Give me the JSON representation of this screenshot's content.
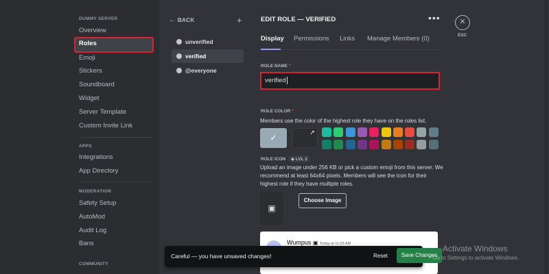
{
  "sidebar": {
    "server_heading": "DUMMY SERVER",
    "items": [
      "Overview",
      "Roles",
      "Emoji",
      "Stickers",
      "Soundboard",
      "Widget",
      "Server Template",
      "Custom Invite Link"
    ],
    "apps_heading": "APPS",
    "apps_items": [
      "Integrations",
      "App Directory"
    ],
    "moderation_heading": "MODERATION",
    "moderation_items": [
      "Safety Setup",
      "AutoMod",
      "Audit Log",
      "Bans"
    ],
    "community_heading": "COMMUNITY"
  },
  "roles_panel": {
    "back_label": "BACK",
    "add_icon": "plus-icon",
    "roles": [
      "unverified",
      "verified",
      "@everyone"
    ]
  },
  "main": {
    "title": "EDIT ROLE — VERIFIED",
    "more_icon": "ellipsis-icon",
    "esc_label": "ESC",
    "tabs": [
      "Display",
      "Permissions",
      "Links",
      "Manage Members (0)"
    ],
    "role_name_label": "ROLE NAME",
    "role_name_value": "verified",
    "role_color_label": "ROLE COLOR",
    "role_color_desc": "Members use the color of the highest role they have on the roles list.",
    "default_color": "#99aab5",
    "swatches_row1": [
      "#1abc9c",
      "#2ecc71",
      "#3498db",
      "#9b59b6",
      "#e91e63",
      "#f1c40f",
      "#e67e22",
      "#e74c3c",
      "#95a5a6",
      "#607d8b"
    ],
    "swatches_row2": [
      "#11806a",
      "#1f8b4c",
      "#206694",
      "#71368a",
      "#ad1457",
      "#c27c0e",
      "#a84300",
      "#992d22",
      "#979c9f",
      "#546e7a"
    ],
    "role_icon_label": "ROLE ICON",
    "lvl_badge": "LVL 2",
    "role_icon_desc": "Upload an image under 256 KB or pick a custom emoji from this server. We recommend at least 64x64 pixels. Members will see the icon for their highest role if they have multiple roles.",
    "choose_image_label": "Choose Image",
    "preview": {
      "username": "Wumpus",
      "timestamp": "Today at 11:55 AM"
    }
  },
  "toast": {
    "message": "Careful — you have unsaved changes!",
    "reset_label": "Reset",
    "save_label": "Save Changes",
    "accent": "#248046"
  },
  "watermark": {
    "title": "Activate Windows",
    "subtitle": "Go to Settings to activate Windows."
  }
}
